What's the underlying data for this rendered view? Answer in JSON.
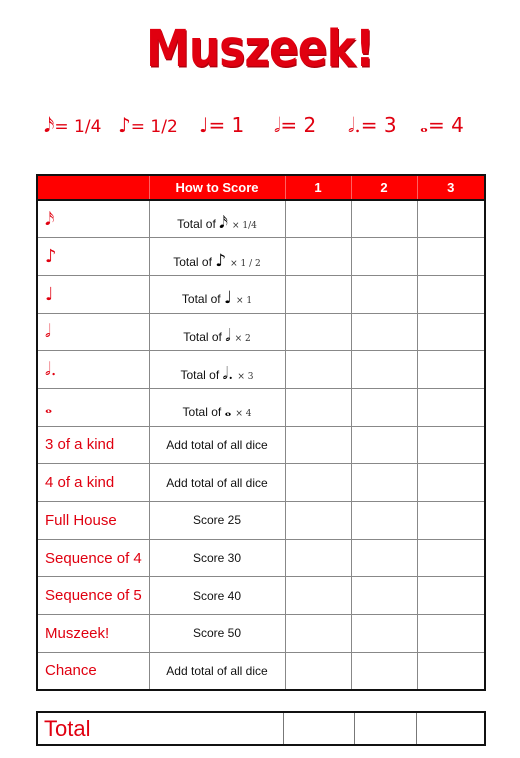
{
  "title": "Muszeek!",
  "legend": [
    {
      "icon": "sixteenth-note-icon",
      "glyph": "𝅘𝅥𝅯",
      "value": "= 1/4",
      "small": true
    },
    {
      "icon": "eighth-note-icon",
      "glyph": "♪",
      "value": "= 1/2",
      "small": true
    },
    {
      "icon": "quarter-note-icon",
      "glyph": "♩",
      "value": "= 1",
      "small": false
    },
    {
      "icon": "half-note-icon",
      "glyph": "𝅗𝅥",
      "value": "= 2",
      "small": false
    },
    {
      "icon": "dotted-half-note-icon",
      "glyph": "𝅗𝅥.",
      "value": "= 3",
      "small": false
    },
    {
      "icon": "whole-note-icon",
      "glyph": "𝅝",
      "value": "= 4",
      "small": false
    }
  ],
  "colors": {
    "accent": "#e00010",
    "header_bg": "#ff0000",
    "header_text": "#ffffff"
  },
  "table": {
    "headers": [
      "",
      "How to Score",
      "1",
      "2",
      "3"
    ],
    "rows": [
      {
        "category_icon": "sixteenth-note-icon",
        "category_glyph": "𝅘𝅥𝅯",
        "how_prefix": "Total of",
        "how_glyph": "𝅘𝅥𝅯",
        "how_mult": "× 1/4",
        "scores": [
          "",
          "",
          ""
        ]
      },
      {
        "category_icon": "eighth-note-icon",
        "category_glyph": "♪",
        "how_prefix": "Total of",
        "how_glyph": "♪",
        "how_mult": "× 1 / 2",
        "scores": [
          "",
          "",
          ""
        ]
      },
      {
        "category_icon": "quarter-note-icon",
        "category_glyph": "♩",
        "how_prefix": "Total of",
        "how_glyph": "♩",
        "how_mult": "× 1",
        "scores": [
          "",
          "",
          ""
        ]
      },
      {
        "category_icon": "half-note-icon",
        "category_glyph": "𝅗𝅥",
        "how_prefix": "Total of",
        "how_glyph": "𝅗𝅥",
        "how_mult": "× 2",
        "scores": [
          "",
          "",
          ""
        ]
      },
      {
        "category_icon": "dotted-half-note-icon",
        "category_glyph": "𝅗𝅥.",
        "how_prefix": "Total of",
        "how_glyph": "𝅗𝅥.",
        "how_mult": "× 3",
        "scores": [
          "",
          "",
          ""
        ]
      },
      {
        "category_icon": "whole-note-icon",
        "category_glyph": "𝅝",
        "how_prefix": "Total of",
        "how_glyph": "𝅝",
        "how_mult": "× 4",
        "scores": [
          "",
          "",
          ""
        ]
      },
      {
        "category": "3 of a kind",
        "how": "Add total of all dice",
        "scores": [
          "",
          "",
          ""
        ]
      },
      {
        "category": "4 of a kind",
        "how": "Add total of all dice",
        "scores": [
          "",
          "",
          ""
        ]
      },
      {
        "category": "Full House",
        "how": "Score 25",
        "scores": [
          "",
          "",
          ""
        ]
      },
      {
        "category": "Sequence of 4",
        "how": "Score 30",
        "scores": [
          "",
          "",
          ""
        ]
      },
      {
        "category": "Sequence of 5",
        "how": "Score 40",
        "scores": [
          "",
          "",
          ""
        ]
      },
      {
        "category": "Muszeek!",
        "how": "Score 50",
        "scores": [
          "",
          "",
          ""
        ]
      },
      {
        "category": "Chance",
        "how": "Add total of all dice",
        "scores": [
          "",
          "",
          ""
        ]
      }
    ]
  },
  "total": {
    "label": "Total",
    "scores": [
      "",
      "",
      ""
    ]
  }
}
